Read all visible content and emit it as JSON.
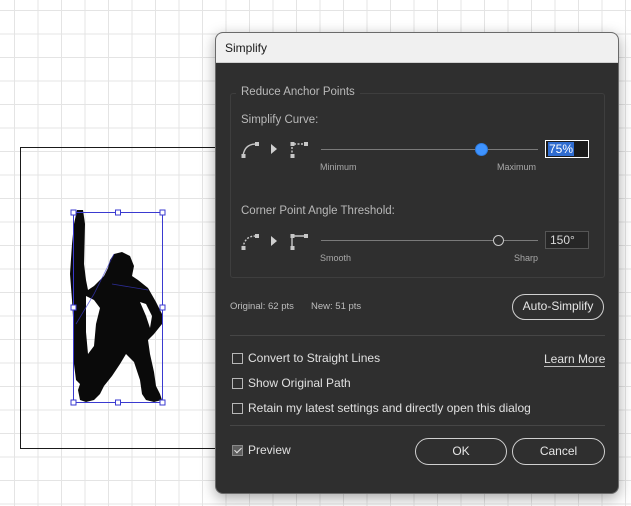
{
  "dialog": {
    "title": "Simplify",
    "section_title": "Reduce Anchor Points",
    "simplify_curve": {
      "label": "Simplify Curve:",
      "min_label": "Minimum",
      "max_label": "Maximum",
      "value_text": "75%",
      "value": 0.75
    },
    "corner_threshold": {
      "label": "Corner Point Angle Threshold:",
      "min_label": "Smooth",
      "max_label": "Sharp",
      "value_text": "150°",
      "value": 0.83
    },
    "original_points": "Original: 62 pts",
    "new_points": "New: 51 pts",
    "auto_simplify_label": "Auto-Simplify",
    "convert_label": "Convert to Straight Lines",
    "learn_more_label": "Learn More",
    "show_original_label": "Show Original Path",
    "retain_label": "Retain my latest settings and directly open this dialog",
    "preview_label": "Preview",
    "ok_label": "OK",
    "cancel_label": "Cancel",
    "convert_checked": false,
    "show_original_checked": false,
    "retain_checked": false,
    "preview_checked": true
  },
  "colors": {
    "dialog_bg": "#2f2f2f",
    "accent": "#3e93ff",
    "selection": "#3a3ad0"
  },
  "icons": [
    "curve-smooth-icon",
    "arrow-right-icon",
    "curve-simplified-icon",
    "corner-smooth-icon",
    "corner-sharp-icon"
  ]
}
